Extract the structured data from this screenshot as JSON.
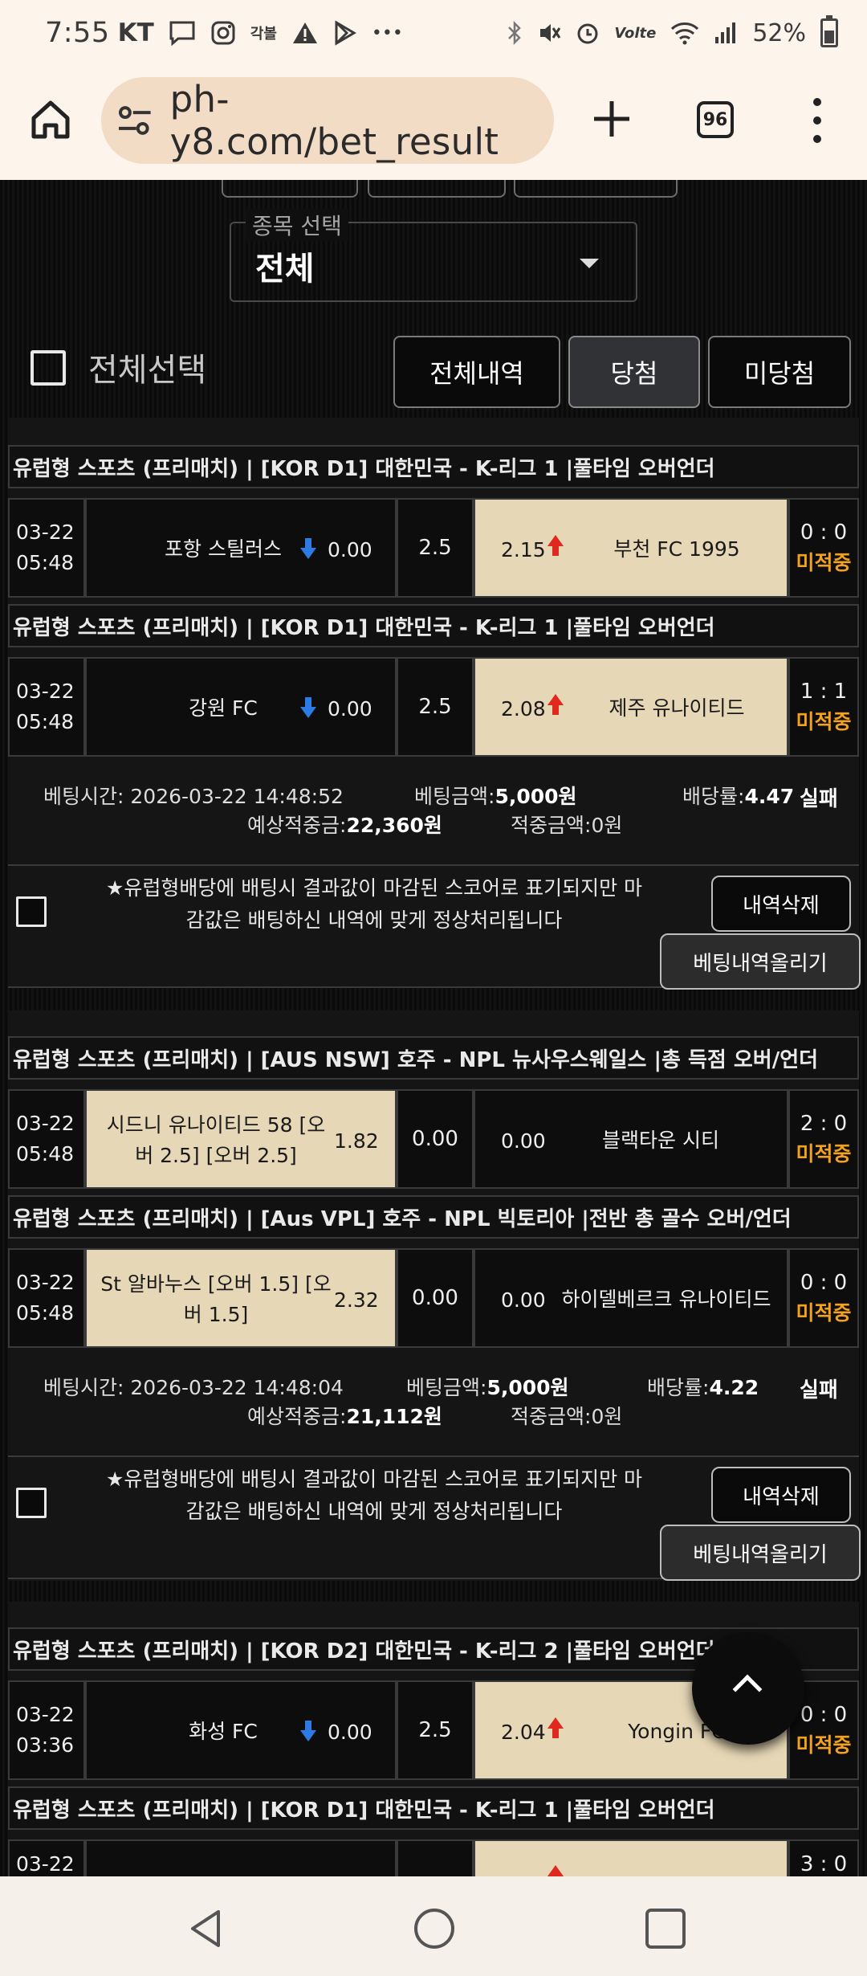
{
  "status_bar": {
    "time": "7:55",
    "carrier": "KT",
    "small_badge": "각볼",
    "volte": "Volte",
    "battery": "52%"
  },
  "browser": {
    "url": "ph-y8.com/bet_result",
    "tab_count": "96"
  },
  "filter": {
    "legend": "종목 선택",
    "value": "전체",
    "select_all": "전체선택",
    "buttons": [
      "전체내역",
      "당첨",
      "미당첨"
    ]
  },
  "labels": {
    "status_pending": "미적중",
    "bet_time": "베팅시간:",
    "bet_amount": "베팅금액:",
    "odds_rate": "배당률:",
    "expected_win": "예상적중금:",
    "win_amount": "적중금액:",
    "delete": "내역삭제",
    "upload": "베팅내역올리기",
    "notice_line1": "★유럽형배당에 배팅시 결과값이 마감된 스코어로 표기되지만 마",
    "notice_line2": "감값은 배팅하신 내역에 맞게 정상처리됩니다"
  },
  "bets": [
    {
      "matches": [
        {
          "league": "유럽형 스포츠 (프리매치) | [KOR D1] 대한민국 - K-리그 1 |풀타임 오버언더",
          "date": "03-22",
          "time": "05:48",
          "home": "포항 스틸러스",
          "home_odds": "0.00",
          "line": "2.5",
          "away": "부천 FC 1995",
          "away_odds": "2.15",
          "score": "0 : 0",
          "status": "미적중"
        },
        {
          "league": "유럽형 스포츠 (프리매치) | [KOR D1] 대한민국 - K-리그 1 |풀타임 오버언더",
          "date": "03-22",
          "time": "05:48",
          "home": "강원 FC",
          "home_odds": "0.00",
          "line": "2.5",
          "away": "제주 유나이티드",
          "away_odds": "2.08",
          "score": "1 : 1",
          "status": "미적중"
        }
      ],
      "bet_time": "2026-03-22 14:48:52",
      "bet_amount": "5,000원",
      "odds": "4.47",
      "expected": "22,360원",
      "won": "0원",
      "result": "실패"
    },
    {
      "matches": [
        {
          "league": "유럽형 스포츠 (프리매치) | [AUS NSW] 호주 - NPL 뉴사우스웨일스 |총 득점 오버/언더",
          "date": "03-22",
          "time": "05:48",
          "home_l1": "시드니 유나이티드 58 [오",
          "home_l2": "버 2.5] [오버 2.5]",
          "home_odds": "1.82",
          "line": "0.00",
          "away": "블랙타운 시티",
          "away_odds": "0.00",
          "score": "2 : 0",
          "status": "미적중"
        },
        {
          "league": "유럽형 스포츠 (프리매치) | [Aus VPL] 호주 - NPL 빅토리아 |전반 총 골수 오버/언더",
          "date": "03-22",
          "time": "05:48",
          "home_l1": "St 알바누스 [오버 1.5] [오",
          "home_l2": "버 1.5]",
          "home_odds": "2.32",
          "line": "0.00",
          "away": "하이델베르크 유나이티드",
          "away_odds": "0.00",
          "score": "0 : 0",
          "status": "미적중"
        }
      ],
      "bet_time": "2026-03-22 14:48:04",
      "bet_amount": "5,000원",
      "odds": "4.22",
      "expected": "21,112원",
      "won": "0원",
      "result": "실패"
    },
    {
      "matches": [
        {
          "league": "유럽형 스포츠 (프리매치) | [KOR D2] 대한민국 - K-리그 2 |풀타임 오버언더",
          "date": "03-22",
          "time": "03:36",
          "home": "화성 FC",
          "home_odds": "0.00",
          "line": "2.5",
          "away": "Yongin FC",
          "away_odds": "2.04",
          "score": "0 : 0",
          "status": "미적중"
        },
        {
          "league": "유럽형 스포츠 (프리매치) | [KOR D1] 대한민국 - K-리그 1 |풀타임 오버언더",
          "date": "03-22",
          "score": "3 : 0"
        }
      ]
    }
  ]
}
